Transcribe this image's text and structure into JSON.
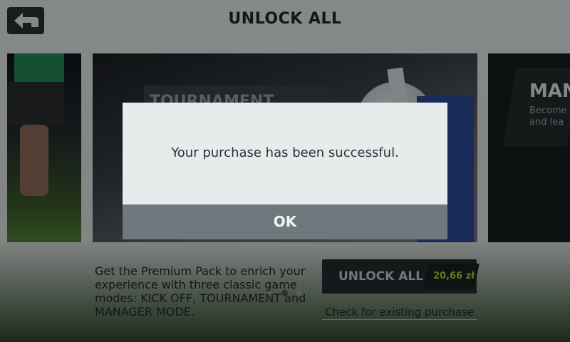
{
  "header": {
    "title": "UNLOCK ALL",
    "back_icon": "back-arrow-icon"
  },
  "carousel": {
    "center_card_title": "TOURNAMENT",
    "right_card_title": "MAN",
    "right_card_desc": "Become\nand lea",
    "page_count": 3,
    "active_page": 2
  },
  "offer": {
    "description": "Get the Premium Pack to enrich your experience with three classic game modes: KICK OFF, TOURNAMENT and MANAGER MODE.",
    "unlock_label": "UNLOCK ALL",
    "price": "20,66 zł",
    "check_purchase": "Check for existing purchase"
  },
  "dialog": {
    "message": "Your purchase has been successful.",
    "ok_label": "OK"
  },
  "colors": {
    "price_accent": "#b3c83b",
    "dialog_button": "#6f787d"
  }
}
